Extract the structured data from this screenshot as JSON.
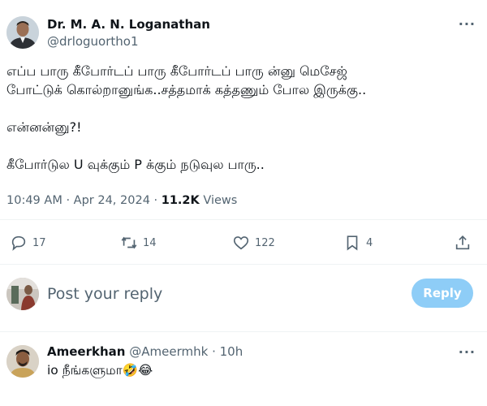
{
  "tweet": {
    "author_name": "Dr. M. A. N. Loganathan",
    "author_handle": "@drloguortho1",
    "more_label": "···",
    "text_lines": [
      "எப்ப பாரு கீபோர்டப் பாரு கீபோர்டப் பாரு  ன்னு மெசேஜ்",
      "போட்டுக் கொல்றானுங்க..சத்தமாக் கத்தணும் போல இருக்கு..",
      "என்னன்னு?!",
      "கீபோர்டுல U வுக்கும் P க்கும் நடுவுல பாரு.."
    ],
    "time": "10:49 AM",
    "separator": "·",
    "date": "Apr 24, 2024",
    "views_count": "11.2K",
    "views_label": "Views"
  },
  "actions": {
    "replies": "17",
    "reposts": "14",
    "likes": "122",
    "bookmarks": "4"
  },
  "reply_box": {
    "placeholder": "Post your reply",
    "button_label": "Reply",
    "button_color": "#8ecdf7"
  },
  "reply": {
    "author_name": "Ameerkhan",
    "author_handle": "@Ameermhk",
    "separator": "·",
    "time": "10h",
    "text": "io நீங்களுமா🤣😂",
    "more_label": "···"
  },
  "icons": [
    "reply-icon",
    "repost-icon",
    "like-icon",
    "bookmark-icon",
    "share-icon",
    "more-icon"
  ],
  "colors": {
    "muted": "#536471",
    "text": "#0f1419",
    "divider": "#eff3f4"
  }
}
